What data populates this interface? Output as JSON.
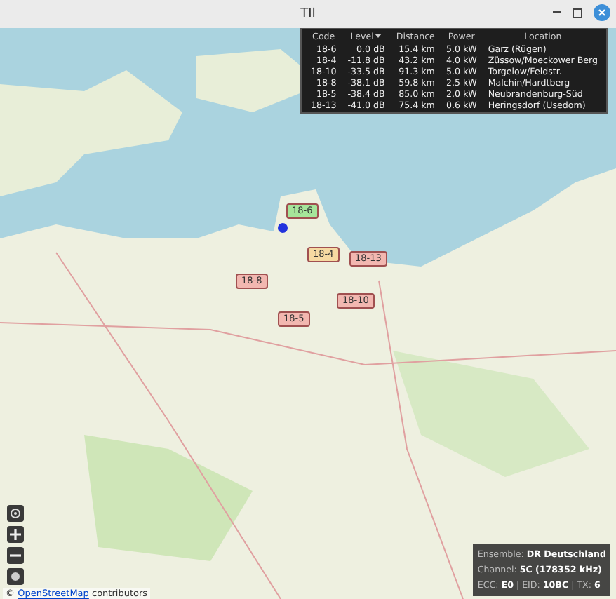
{
  "window": {
    "title": "TII"
  },
  "table": {
    "columns": [
      {
        "label": "Code",
        "sorted": false
      },
      {
        "label": "Level",
        "sorted": true
      },
      {
        "label": "Distance",
        "sorted": false
      },
      {
        "label": "Power",
        "sorted": false
      },
      {
        "label": "Location",
        "sorted": false
      }
    ],
    "rows": [
      {
        "cells": [
          "18-6",
          "0.0 dB",
          "15.4 km",
          "5.0 kW",
          "Garz (Rügen)"
        ]
      },
      {
        "cells": [
          "18-4",
          "-11.8 dB",
          "43.2 km",
          "4.0 kW",
          "Züssow/Moeckower Berg"
        ]
      },
      {
        "cells": [
          "18-10",
          "-33.5 dB",
          "91.3 km",
          "5.0 kW",
          "Torgelow/Feldstr."
        ]
      },
      {
        "cells": [
          "18-8",
          "-38.1 dB",
          "59.8 km",
          "2.5 kW",
          "Malchin/Hardtberg"
        ]
      },
      {
        "cells": [
          "18-5",
          "-38.4 dB",
          "85.0 km",
          "2.0 kW",
          "Neubrandenburg-Süd"
        ]
      },
      {
        "cells": [
          "18-13",
          "-41.0 dB",
          "75.4 km",
          "0.6 kW",
          "Heringsdorf (Usedom)"
        ]
      }
    ]
  },
  "markers": [
    {
      "label": "18-6",
      "color": "#a6e59a"
    },
    {
      "label": "18-4",
      "color": "#f6d9a2"
    },
    {
      "label": "18-13",
      "color": "#f2b7b0"
    },
    {
      "label": "18-8",
      "color": "#f2b7b0"
    },
    {
      "label": "18-10",
      "color": "#f2b7b0"
    },
    {
      "label": "18-5",
      "color": "#f2b7b0"
    }
  ],
  "info": [
    "Ensemble: **DR Deutschland**",
    "Channel: **5C (178352 kHz)**",
    "ECC: **E0** | EID: **10BC** | TX: **6**"
  ],
  "attribution": {
    "prefix": "©",
    "link": "OpenStreetMap",
    "suffix": "contributors"
  }
}
